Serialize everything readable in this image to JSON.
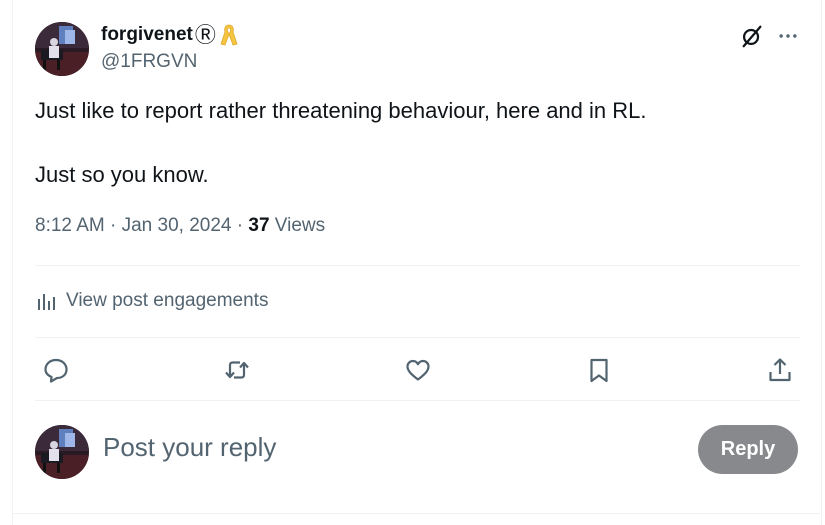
{
  "author": {
    "display_name": "forgivenet",
    "registered_mark": "Ⓡ",
    "handle": "@1FRGVN",
    "badge_icon": "yellow-ribbon-icon"
  },
  "post": {
    "paragraphs": [
      "Just like to report rather threatening behaviour, here and in RL.",
      "Just so you know."
    ],
    "time": "8:12 AM",
    "separator": " · ",
    "date": "Jan 30, 2024",
    "views_count": "37",
    "views_label": " Views"
  },
  "engagements": {
    "label": "View post engagements",
    "icon": "bar-chart-icon"
  },
  "actions": {
    "icons": [
      "reply-icon",
      "repost-icon",
      "like-icon",
      "bookmark-icon",
      "share-icon"
    ]
  },
  "reply_box": {
    "placeholder": "Post your reply",
    "button_label": "Reply"
  },
  "colors": {
    "text_primary": "#0f1419",
    "text_secondary": "#536471",
    "divider": "#eff3f4",
    "reply_button_bg": "#87898c",
    "ribbon": "#f5c542"
  }
}
